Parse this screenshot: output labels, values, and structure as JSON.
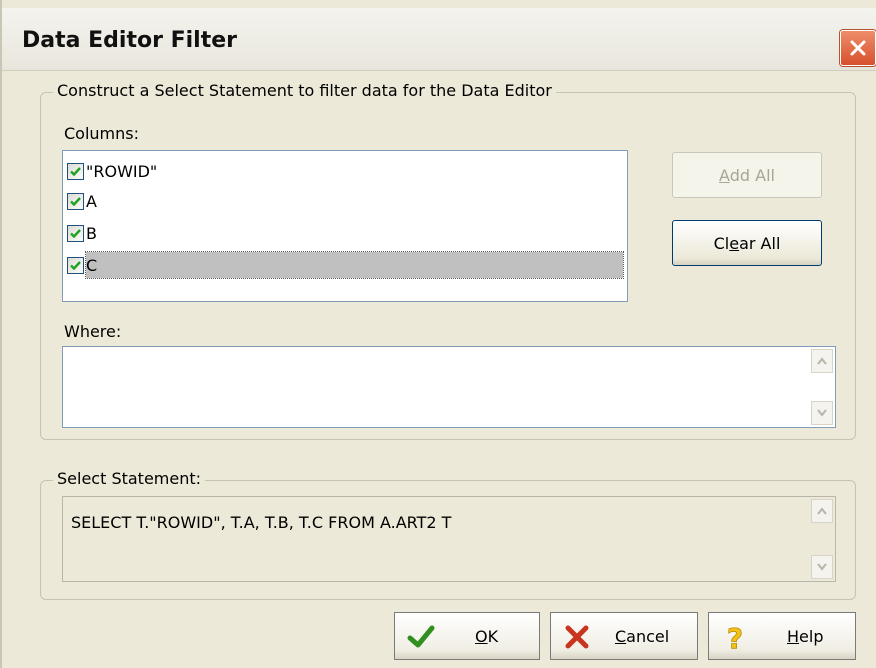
{
  "window": {
    "title": "Data Editor Filter"
  },
  "construct_group": {
    "legend": "Construct a Select Statement to filter data for the Data Editor",
    "columns_label": "Columns:",
    "columns": [
      {
        "label": "\"ROWID\"",
        "checked": true,
        "selected": false
      },
      {
        "label": "A",
        "checked": true,
        "selected": false
      },
      {
        "label": "B",
        "checked": true,
        "selected": false
      },
      {
        "label": "C",
        "checked": true,
        "selected": true
      }
    ],
    "add_all": {
      "pre": "",
      "mnemonic": "A",
      "post": "dd All",
      "enabled": false
    },
    "clear_all": {
      "pre": "Cl",
      "mnemonic": "e",
      "post": "ar All",
      "enabled": true
    },
    "where_label": "Where:",
    "where_value": ""
  },
  "statement_group": {
    "legend": "Select Statement:",
    "statement": "SELECT T.\"ROWID\", T.A, T.B, T.C FROM A.ART2 T"
  },
  "buttons": {
    "ok": {
      "pre": "",
      "mnemonic": "O",
      "post": "K"
    },
    "cancel": {
      "pre": "",
      "mnemonic": "C",
      "post": "ancel"
    },
    "help": {
      "pre": "",
      "mnemonic": "H",
      "post": "elp"
    }
  },
  "icons": {
    "ok": "checkmark-icon",
    "cancel": "x-mark-icon",
    "help": "question-mark-icon",
    "close": "close-icon"
  },
  "colors": {
    "ok_green": "#2f8f1f",
    "cancel_red": "#c8341d",
    "help_yellow": "#f2c21b",
    "close_red": "#d8502d"
  }
}
